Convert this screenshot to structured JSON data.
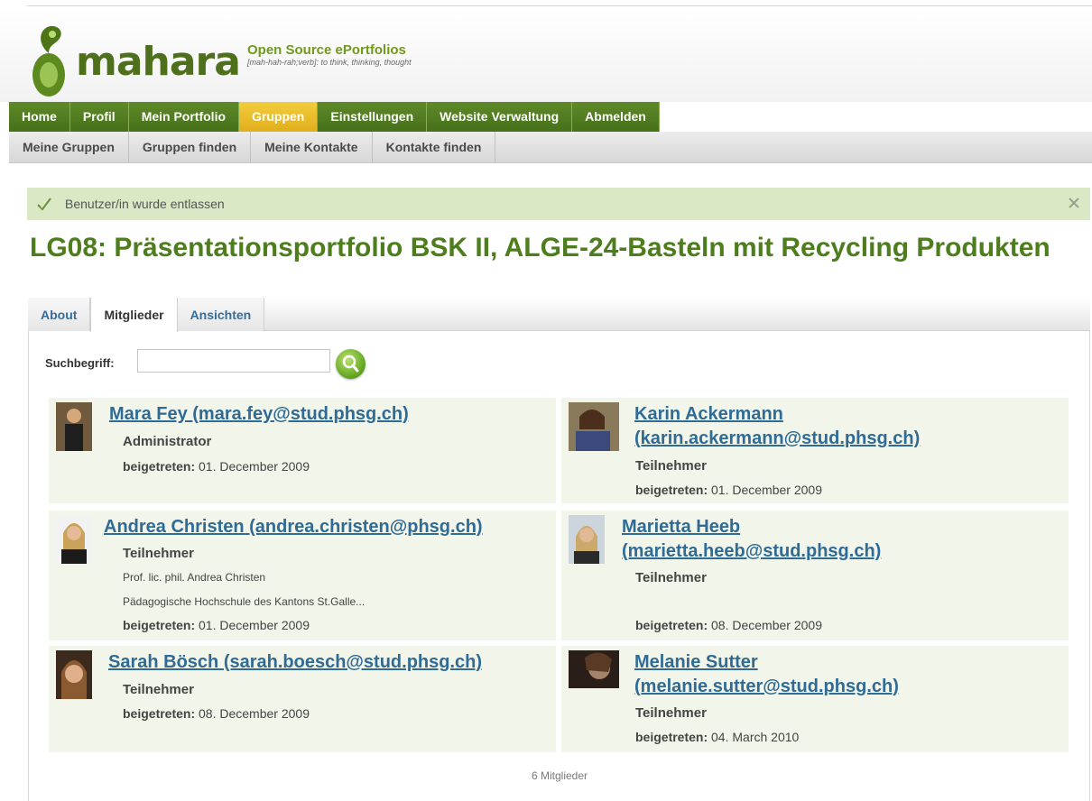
{
  "header": {
    "logo_text": "mahara",
    "tagline_title": "Open Source ePortfolios",
    "tagline_sub": "[mah-hah-rah;verb]: to think, thinking, thought",
    "colors": {
      "brand_green": "#4e7d1d",
      "nav_green": "#5f8a28",
      "nav_active": "#e8b82a",
      "link_blue": "#2f6b95"
    }
  },
  "main_nav": [
    {
      "label": "Home",
      "active": false
    },
    {
      "label": "Profil",
      "active": false
    },
    {
      "label": "Mein Portfolio",
      "active": false
    },
    {
      "label": "Gruppen",
      "active": true
    },
    {
      "label": "Einstellungen",
      "active": false
    },
    {
      "label": "Website Verwaltung",
      "active": false
    },
    {
      "label": "Abmelden",
      "active": false
    }
  ],
  "sub_nav": [
    {
      "label": "Meine Gruppen"
    },
    {
      "label": "Gruppen finden"
    },
    {
      "label": "Meine Kontakte"
    },
    {
      "label": "Kontakte finden"
    }
  ],
  "message": {
    "text": "Benutzer/in wurde entlassen",
    "icon": "check-icon",
    "close_icon": "close-icon"
  },
  "page_title": "LG08: Präsentationsportfolio BSK II, ALGE-24-Basteln mit Recycling Produkten",
  "tabs": [
    {
      "label": "About",
      "active": false
    },
    {
      "label": "Mitglieder",
      "active": true
    },
    {
      "label": "Ansichten",
      "active": false
    }
  ],
  "search": {
    "label": "Suchbegriff:",
    "value": "",
    "placeholder": "",
    "button_icon": "search-icon"
  },
  "members": [
    {
      "name": "Mara Fey (mara.fey@stud.phsg.ch)",
      "role": "Administrator",
      "details": [],
      "joined_label": "beigetreten:",
      "joined_date": "01. December 2009"
    },
    {
      "name": "Karin Ackermann (karin.ackermann@stud.phsg.ch)",
      "role": "Teilnehmer",
      "details": [],
      "joined_label": "beigetreten:",
      "joined_date": "01. December 2009"
    },
    {
      "name": "Andrea Christen (andrea.christen@phsg.ch)",
      "role": "Teilnehmer",
      "details": [
        "Prof. lic. phil. Andrea Christen",
        "Pädagogische Hochschule des Kantons St.Galle..."
      ],
      "joined_label": "beigetreten:",
      "joined_date": "01. December 2009"
    },
    {
      "name": "Marietta Heeb (marietta.heeb@stud.phsg.ch)",
      "role": "Teilnehmer",
      "details": [],
      "joined_label": "beigetreten:",
      "joined_date": "08. December 2009"
    },
    {
      "name": "Sarah Bösch (sarah.boesch@stud.phsg.ch)",
      "role": "Teilnehmer",
      "details": [],
      "joined_label": "beigetreten:",
      "joined_date": "08. December 2009"
    },
    {
      "name": "Melanie Sutter (melanie.sutter@stud.phsg.ch)",
      "role": "Teilnehmer",
      "details": [],
      "joined_label": "beigetreten:",
      "joined_date": "04. March 2010"
    }
  ],
  "member_count": "6 Mitglieder"
}
